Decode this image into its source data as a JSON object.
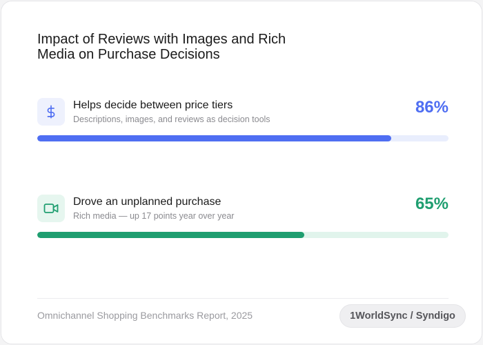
{
  "chart_data": {
    "type": "bar",
    "title": "Impact of Reviews with Images and Rich Media on Purchase Decisions",
    "categories": [
      "Helps decide between price tiers",
      "Drove an unplanned purchase"
    ],
    "values": [
      86,
      65
    ],
    "unit": "%",
    "ylim": [
      0,
      100
    ],
    "items": [
      {
        "label": "Helps decide between price tiers",
        "subtitle": "Descriptions, images, and reviews as decision tools",
        "value": 86,
        "value_text": "86%",
        "icon": "dollar-icon",
        "color": "#4f6ef2",
        "track_color": "#e9eefd",
        "icon_bg": "#eef1fd"
      },
      {
        "label": "Drove an unplanned purchase",
        "subtitle": "Rich media — up 17 points year over year",
        "value": 65,
        "value_text": "65%",
        "icon": "video-camera-icon",
        "color": "#1f9e70",
        "track_color": "#e1f4ec",
        "icon_bg": "#e6f6ef"
      }
    ],
    "source": "Omnichannel Shopping Benchmarks Report, 2025",
    "brand": "1WorldSync / Syndigo"
  }
}
